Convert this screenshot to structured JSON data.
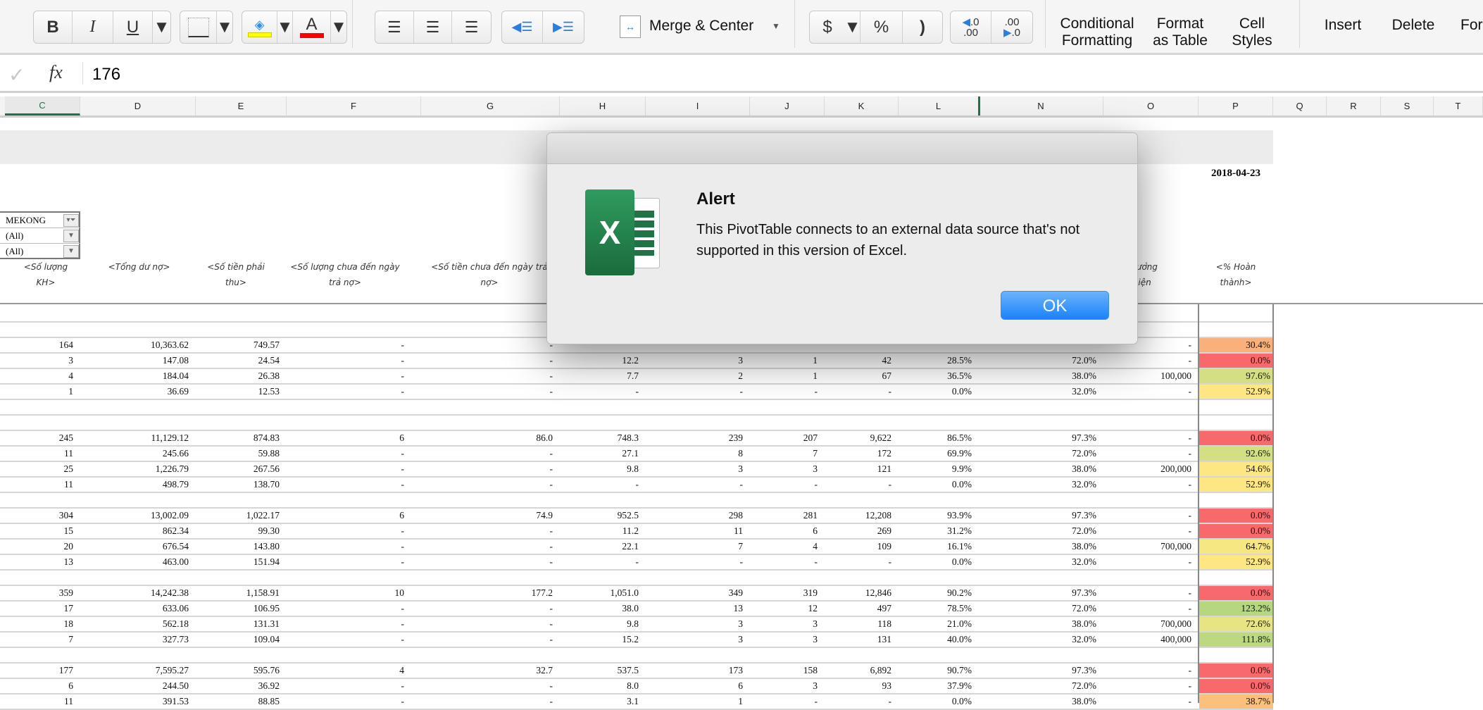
{
  "ribbon": {
    "bold": "B",
    "italic": "I",
    "underline": "U",
    "font_color_glyph": "A",
    "merge_center": "Merge & Center",
    "currency": "$",
    "percent": "%",
    "comma": ")",
    "inc_decimal_top": ".0",
    "inc_decimal_bottom": ".00",
    "dec_decimal_top": ".00",
    "dec_decimal_bottom": ".0",
    "conditional_formatting": [
      "Conditional",
      "Formatting"
    ],
    "format_as_table": [
      "Format",
      "as Table"
    ],
    "cell_styles": [
      "Cell",
      "Styles"
    ],
    "insert": "Insert",
    "delete": "Delete",
    "format": "For",
    "fill_color": "#ffff00",
    "font_color": "#ff0000"
  },
  "formula_bar": {
    "fx": "fx",
    "value": "176"
  },
  "columns": [
    "C",
    "D",
    "E",
    "F",
    "G",
    "H",
    "I",
    "J",
    "K",
    "L",
    "N",
    "O",
    "P",
    "Q",
    "R",
    "S",
    "T"
  ],
  "sheet": {
    "date": "2018-04-23",
    "filters": [
      "MEKONG",
      "(All)",
      "(All)"
    ],
    "headers": [
      "<Số lượng KH>",
      "<Tổng dư nợ>",
      "<Số tiền phải thu>",
      "<Số lượng chưa đến ngày trả nợ>",
      "<Số tiền chưa đến ngày trả nợ>"
    ],
    "header_o_partial": [
      "n thưởng",
      "ến hiện",
      "tại>"
    ],
    "header_p": "<% Hoàn thành>"
  },
  "table": {
    "rows": [
      [
        "164",
        "10,363.62",
        "749.57",
        "-",
        "-",
        "",
        "",
        "",
        "",
        "",
        "",
        "-",
        "30.4%"
      ],
      [
        "3",
        "147.08",
        "24.54",
        "-",
        "-",
        "12.2",
        "3",
        "1",
        "42",
        "28.5%",
        "72.0%",
        "-",
        "0.0%"
      ],
      [
        "4",
        "184.04",
        "26.38",
        "-",
        "-",
        "7.7",
        "2",
        "1",
        "67",
        "36.5%",
        "38.0%",
        "100,000",
        "97.6%"
      ],
      [
        "1",
        "36.69",
        "12.53",
        "-",
        "-",
        "-",
        "-",
        "-",
        "-",
        "0.0%",
        "32.0%",
        "-",
        "52.9%"
      ],
      [
        "245",
        "11,129.12",
        "874.83",
        "6",
        "86.0",
        "748.3",
        "239",
        "207",
        "9,622",
        "86.5%",
        "97.3%",
        "-",
        "0.0%"
      ],
      [
        "11",
        "245.66",
        "59.88",
        "-",
        "-",
        "27.1",
        "8",
        "7",
        "172",
        "69.9%",
        "72.0%",
        "-",
        "92.6%"
      ],
      [
        "25",
        "1,226.79",
        "267.56",
        "-",
        "-",
        "9.8",
        "3",
        "3",
        "121",
        "9.9%",
        "38.0%",
        "200,000",
        "54.6%"
      ],
      [
        "11",
        "498.79",
        "138.70",
        "-",
        "-",
        "-",
        "-",
        "-",
        "-",
        "0.0%",
        "32.0%",
        "-",
        "52.9%"
      ],
      [
        "304",
        "13,002.09",
        "1,022.17",
        "6",
        "74.9",
        "952.5",
        "298",
        "281",
        "12,208",
        "93.9%",
        "97.3%",
        "-",
        "0.0%"
      ],
      [
        "15",
        "862.34",
        "99.30",
        "-",
        "-",
        "11.2",
        "11",
        "6",
        "269",
        "31.2%",
        "72.0%",
        "-",
        "0.0%"
      ],
      [
        "20",
        "676.54",
        "143.80",
        "-",
        "-",
        "22.1",
        "7",
        "4",
        "109",
        "16.1%",
        "38.0%",
        "700,000",
        "64.7%"
      ],
      [
        "13",
        "463.00",
        "151.94",
        "-",
        "-",
        "-",
        "-",
        "-",
        "-",
        "0.0%",
        "32.0%",
        "-",
        "52.9%"
      ],
      [
        "359",
        "14,242.38",
        "1,158.91",
        "10",
        "177.2",
        "1,051.0",
        "349",
        "319",
        "12,846",
        "90.2%",
        "97.3%",
        "-",
        "0.0%"
      ],
      [
        "17",
        "633.06",
        "106.95",
        "-",
        "-",
        "38.0",
        "13",
        "12",
        "497",
        "78.5%",
        "72.0%",
        "-",
        "123.2%"
      ],
      [
        "18",
        "562.18",
        "131.31",
        "-",
        "-",
        "9.8",
        "3",
        "3",
        "118",
        "21.0%",
        "38.0%",
        "700,000",
        "72.6%"
      ],
      [
        "7",
        "327.73",
        "109.04",
        "-",
        "-",
        "15.2",
        "3",
        "3",
        "131",
        "40.0%",
        "32.0%",
        "400,000",
        "111.8%"
      ],
      [
        "177",
        "7,595.27",
        "595.76",
        "4",
        "32.7",
        "537.5",
        "173",
        "158",
        "6,892",
        "90.7%",
        "97.3%",
        "-",
        "0.0%"
      ],
      [
        "6",
        "244.50",
        "36.92",
        "-",
        "-",
        "8.0",
        "6",
        "3",
        "93",
        "37.9%",
        "72.0%",
        "-",
        "0.0%"
      ],
      [
        "11",
        "391.53",
        "88.85",
        "-",
        "-",
        "3.1",
        "1",
        "-",
        "-",
        "0.0%",
        "38.0%",
        "-",
        "38.7%"
      ]
    ],
    "pct_colors": [
      "#f9b07a",
      "#f8696b",
      "#d3df82",
      "#fee783",
      "#f8696b",
      "#d3df82",
      "#fde783",
      "#fee783",
      "#f8696b",
      "#f8696b",
      "#f6e783",
      "#fee783",
      "#f8696b",
      "#b6d780",
      "#e6e483",
      "#bcd880",
      "#f8696b",
      "#f8696b",
      "#fbc07c"
    ]
  },
  "dialog": {
    "title": "Alert",
    "message": "This PivotTable connects to an external data source that's not supported in this version of Excel.",
    "ok": "OK"
  }
}
